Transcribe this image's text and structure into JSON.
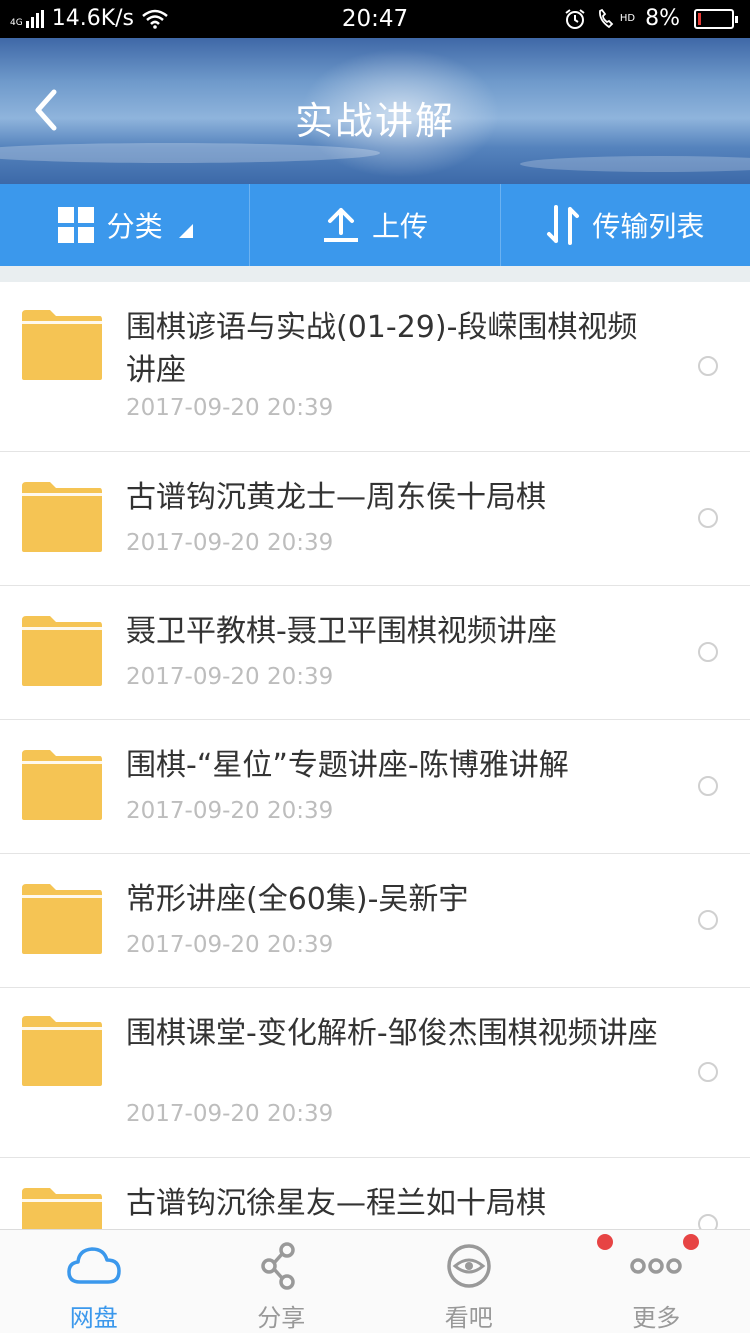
{
  "status_bar": {
    "network": "4G",
    "speed": "14.6K/s",
    "time": "20:47",
    "hd_label": "HD",
    "battery": "8%",
    "battery_level": 0.08
  },
  "header": {
    "title": "实战讲解"
  },
  "toolbar": {
    "category_label": "分类",
    "upload_label": "上传",
    "transfer_label": "传输列表"
  },
  "files": [
    {
      "name": "围棋谚语与实战(01-29)-段嵘围棋视频讲座",
      "date": "2017-09-20  20:39"
    },
    {
      "name": "古谱钩沉黄龙士—周东侯十局棋",
      "date": "2017-09-20  20:39"
    },
    {
      "name": "聂卫平教棋-聂卫平围棋视频讲座",
      "date": "2017-09-20  20:39"
    },
    {
      "name": "围棋-“星位”专题讲座-陈博雅讲解",
      "date": "2017-09-20  20:39"
    },
    {
      "name": "常形讲座(全60集)-吴新宇",
      "date": "2017-09-20  20:39"
    },
    {
      "name": "围棋课堂-变化解析-邹俊杰围棋视频讲座",
      "date": "2017-09-20  20:39"
    },
    {
      "name": "古谱钩沉徐星友—程兰如十局棋",
      "date": ""
    }
  ],
  "nav": {
    "items": [
      {
        "label": "网盘",
        "icon": "cloud-icon",
        "active": true
      },
      {
        "label": "分享",
        "icon": "share-icon"
      },
      {
        "label": "看吧",
        "icon": "eye-icon",
        "badge": true
      },
      {
        "label": "更多",
        "icon": "more-icon",
        "badge": true
      }
    ]
  },
  "colors": {
    "accent": "#3b98ec",
    "folder": "#f5c454",
    "badge": "#e74444"
  }
}
